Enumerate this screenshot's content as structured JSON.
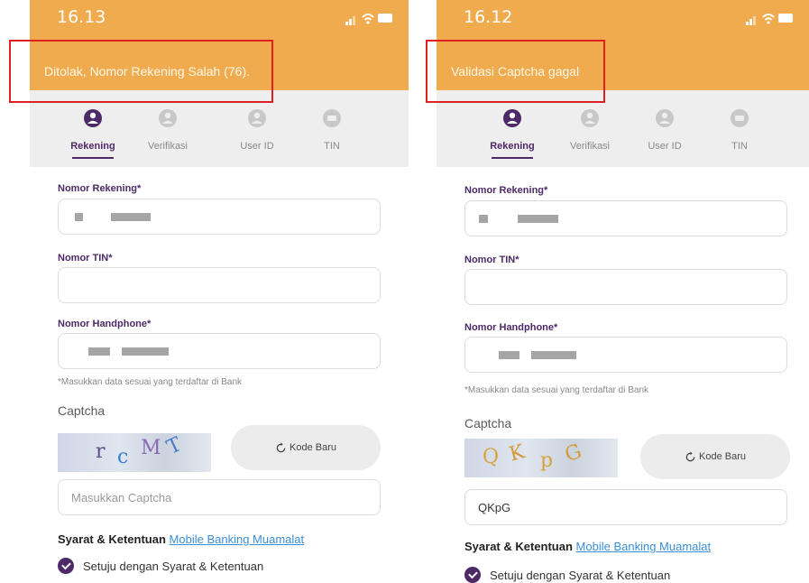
{
  "colors": {
    "header_orange": "#efab4d",
    "brand_purple": "#4d2a67",
    "tab_bar_gray": "#eeeeee",
    "link_blue": "#3a8fd6",
    "highlight_red": "#e0201e"
  },
  "screens": [
    {
      "time": "16.13",
      "message": "Ditolak, Nomor Rekening Salah (76).",
      "tabs": [
        {
          "label": "Rekening",
          "icon": "user-circle-icon",
          "active": true
        },
        {
          "label": "Verifikasi",
          "icon": "user-verify-icon",
          "active": false
        },
        {
          "label": "User ID",
          "icon": "user-id-icon",
          "active": false
        },
        {
          "label": "TIN",
          "icon": "user-tin-icon",
          "active": false
        }
      ],
      "form": {
        "account_label": "Nomor Rekening*",
        "tin_label": "Nomor TIN*",
        "phone_label": "Nomor Handphone*",
        "hint": "*Masukkan data sesuai yang terdaftar di Bank",
        "captcha_label": "Captcha",
        "captcha_text": "rcMT",
        "refresh_label": "Kode Baru",
        "captcha_placeholder": "Masukkan Captcha",
        "captcha_value": "",
        "terms_head": "Syarat & Ketentuan",
        "terms_link": "Mobile Banking Muamalat",
        "agree_label": "Setuju dengan Syarat & Ketentuan"
      }
    },
    {
      "time": "16.12",
      "message": "Validasi Captcha gagal",
      "tabs": [
        {
          "label": "Rekening",
          "icon": "user-circle-icon",
          "active": true
        },
        {
          "label": "Verifikasi",
          "icon": "user-verify-icon",
          "active": false
        },
        {
          "label": "User ID",
          "icon": "user-id-icon",
          "active": false
        },
        {
          "label": "TIN",
          "icon": "user-tin-icon",
          "active": false
        }
      ],
      "form": {
        "account_label": "Nomor Rekening*",
        "tin_label": "Nomor TIN*",
        "phone_label": "Nomor Handphone*",
        "hint": "*Masukkan data sesuai yang terdaftar di Bank",
        "captcha_label": "Captcha",
        "captcha_text": "QKpG",
        "refresh_label": "Kode Baru",
        "captcha_placeholder": "Masukkan Captcha",
        "captcha_value": "QKpG",
        "terms_head": "Syarat & Ketentuan",
        "terms_link": "Mobile Banking Muamalat",
        "agree_label": "Setuju dengan Syarat & Ketentuan"
      }
    }
  ]
}
